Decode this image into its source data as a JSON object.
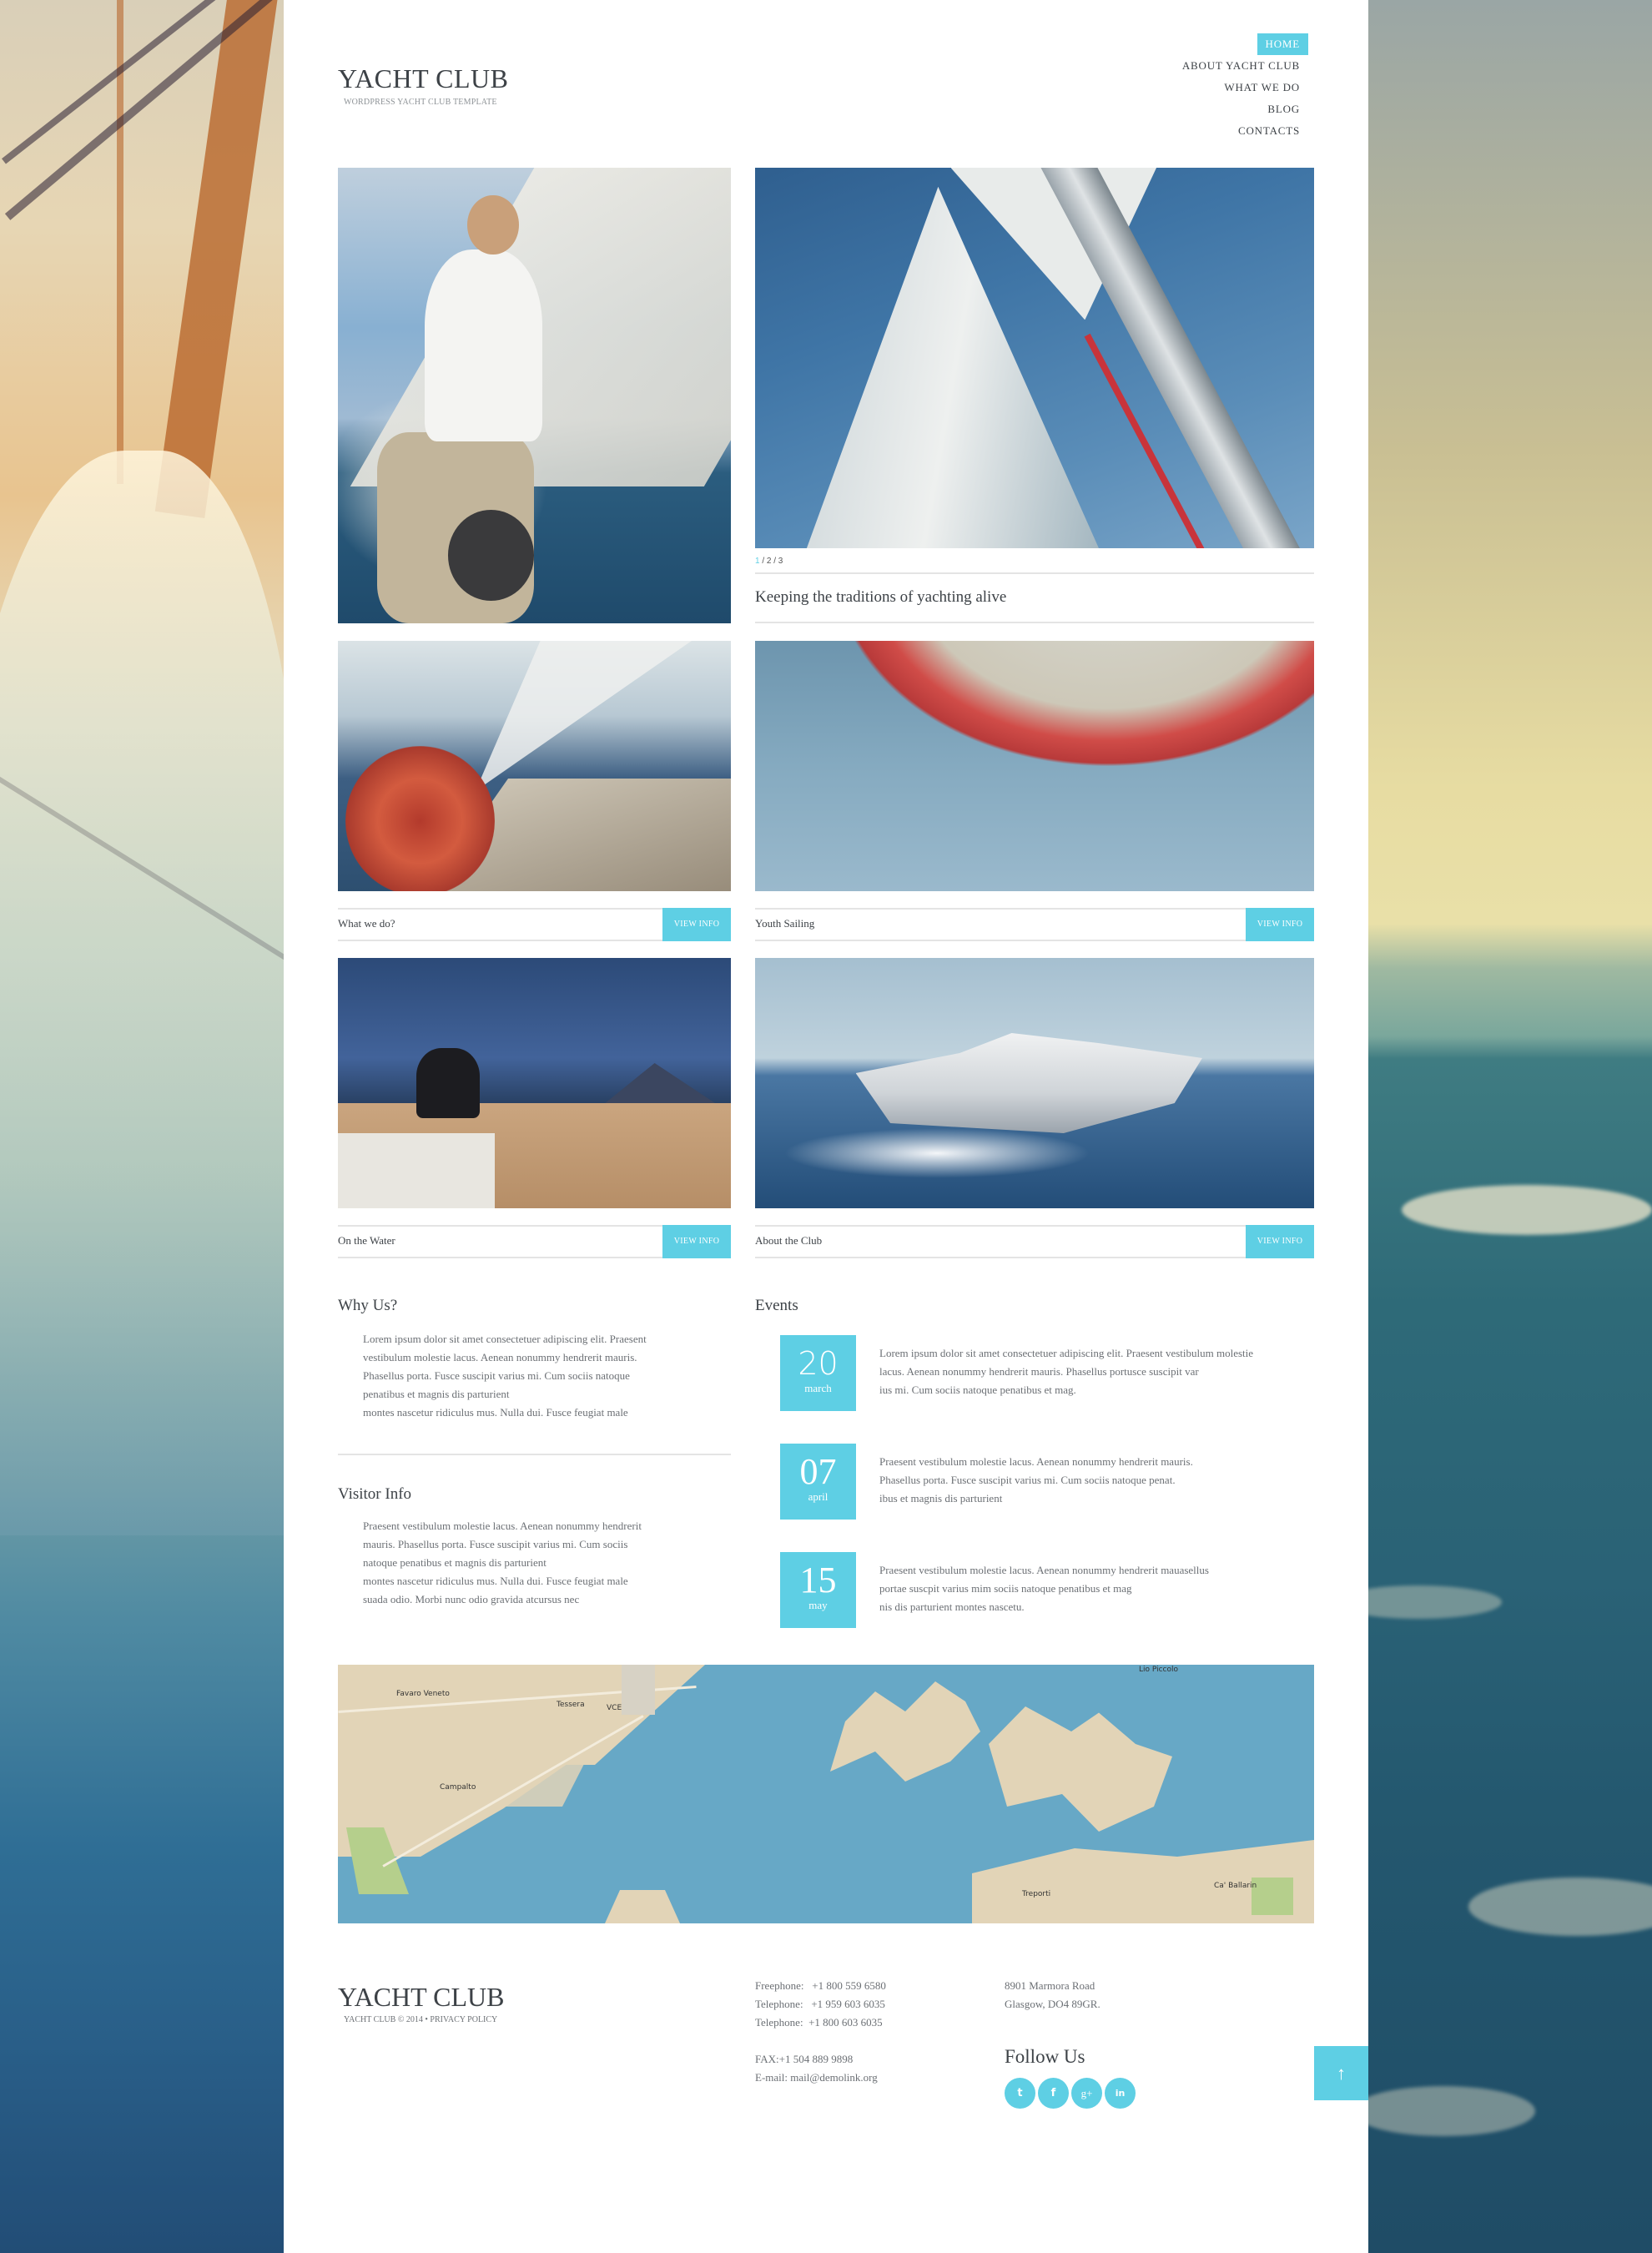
{
  "header": {
    "logo_title": "YACHT CLUB",
    "logo_subtitle": "WORDPRESS YACHT CLUB TEMPLATE"
  },
  "nav": {
    "items": [
      {
        "label": "HOME",
        "active": true
      },
      {
        "label": "ABOUT YACHT CLUB",
        "active": false
      },
      {
        "label": "WHAT WE DO",
        "active": false
      },
      {
        "label": "BLOG",
        "active": false
      },
      {
        "label": "CONTACTS",
        "active": false
      }
    ]
  },
  "slider": {
    "pager": {
      "current": "1",
      "rest": " / 2 / 3"
    },
    "caption": "Keeping the traditions of yachting alive"
  },
  "tiles": [
    {
      "label": "What we do?",
      "button": "VIEW INFO"
    },
    {
      "label": "Youth Sailing",
      "button": "VIEW INFO"
    },
    {
      "label": "On the Water",
      "button": "VIEW INFO"
    },
    {
      "label": "About the Club",
      "button": "VIEW INFO"
    }
  ],
  "why_us": {
    "title": "Why Us?",
    "text": "Lorem ipsum dolor sit amet consectetuer adipiscing elit. Praesent\nvestibulum molestie lacus. Aenean nonummy hendrerit mauris.\nPhasellus porta. Fusce suscipit varius mi. Cum sociis natoque\npenatibus et magnis dis parturient\nmontes nascetur ridiculus mus. Nulla dui. Fusce feugiat male"
  },
  "visitor_info": {
    "title": "Visitor Info",
    "text": "Praesent vestibulum molestie lacus. Aenean nonummy hendrerit\nmauris. Phasellus porta. Fusce suscipit varius mi. Cum sociis\nnatoque penatibus et magnis dis parturient\nmontes nascetur ridiculus mus. Nulla dui. Fusce feugiat male\nsuada odio. Morbi nunc odio gravida atcursus nec"
  },
  "events": {
    "title": "Events",
    "items": [
      {
        "day": "20",
        "month": "march",
        "text": "Lorem ipsum dolor sit amet consectetuer adipiscing elit. Praesent vestibulum molestie\nlacus. Aenean nonummy hendrerit mauris. Phasellus portusce suscipit var\nius mi. Cum sociis natoque penatibus et mag."
      },
      {
        "day": "07",
        "month": "april",
        "text": "Praesent vestibulum molestie lacus. Aenean nonummy hendrerit mauris.\nPhasellus porta. Fusce suscipit varius mi. Cum sociis natoque penat.\nibus et magnis dis parturient"
      },
      {
        "day": "15",
        "month": "may",
        "text": "Praesent vestibulum molestie lacus. Aenean nonummy hendrerit mauasellus\nportae suscpit varius mim sociis natoque penatibus et mag\nnis dis parturient montes nascetu."
      }
    ]
  },
  "map": {
    "labels": [
      "Favaro Veneto",
      "Tessera",
      "VCE",
      "Campalto",
      "Lio Piccolo",
      "Treporti",
      "Ca' Ballarin"
    ]
  },
  "footer": {
    "logo_title": "YACHT CLUB",
    "copyright": "YACHT CLUB © 2014 • PRIVACY POLICY",
    "phones": [
      "Freephone:   +1 800 559 6580",
      "Telephone:   +1 959 603 6035",
      "Telephone:  +1 800 603 6035"
    ],
    "fax": "FAX:+1 504 889 9898",
    "email": "E-mail: mail@demolink.org",
    "address": [
      "8901 Marmora Road",
      "Glasgow, DO4 89GR."
    ],
    "follow_title": "Follow Us",
    "social": [
      {
        "name": "twitter",
        "glyph": "t"
      },
      {
        "name": "facebook",
        "glyph": "f"
      },
      {
        "name": "google-plus",
        "glyph": "g+"
      },
      {
        "name": "linkedin",
        "glyph": "in"
      }
    ],
    "to_top_glyph": "↑"
  },
  "colors": {
    "accent": "#5ecfe4",
    "text": "#3d4247",
    "muted": "#6c7075"
  }
}
